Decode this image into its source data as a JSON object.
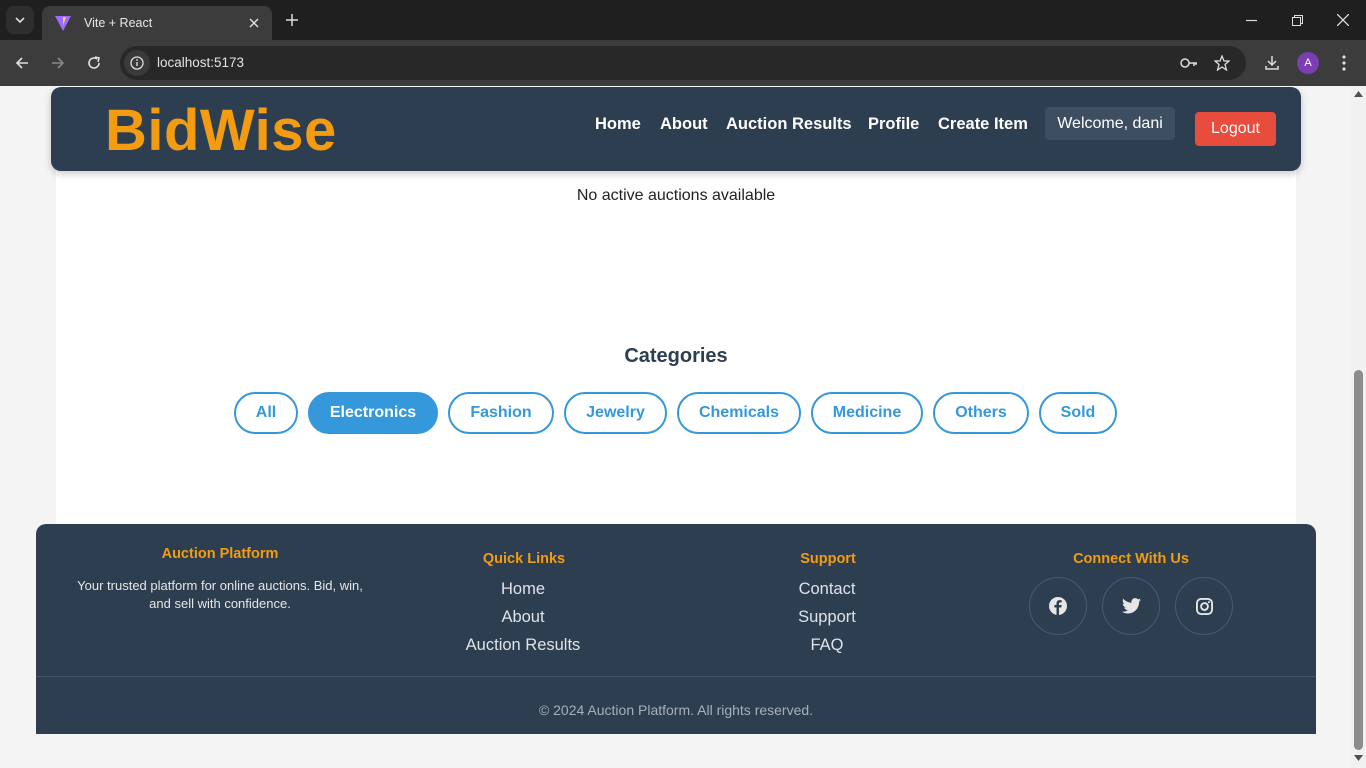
{
  "browser": {
    "tab_title": "Vite + React",
    "url": "localhost:5173",
    "profile_initial": "A"
  },
  "header": {
    "logo": "BidWise",
    "nav": [
      "Home",
      "About",
      "Auction Results",
      "Profile",
      "Create Item"
    ],
    "welcome": "Welcome, dani",
    "logout": "Logout"
  },
  "main": {
    "empty_message": "No active auctions available",
    "categories_title": "Categories",
    "categories": [
      "All",
      "Electronics",
      "Fashion",
      "Jewelry",
      "Chemicals",
      "Medicine",
      "Others",
      "Sold"
    ],
    "active_category": "Electronics"
  },
  "footer": {
    "about_title": "Auction Platform",
    "about_text": "Your trusted platform for online auctions. Bid, win, and sell with confidence.",
    "quick_links_title": "Quick Links",
    "quick_links": [
      "Home",
      "About",
      "Auction Results"
    ],
    "support_title": "Support",
    "support_links": [
      "Contact",
      "Support",
      "FAQ"
    ],
    "connect_title": "Connect With Us",
    "social_icons": [
      "facebook-icon",
      "twitter-icon",
      "instagram-icon"
    ],
    "copyright": "© 2024 Auction Platform. All rights reserved."
  },
  "colors": {
    "header_bg": "#2d3e50",
    "logo": "#f39c12",
    "accent_blue": "#3498db",
    "logout": "#e74c3c"
  }
}
